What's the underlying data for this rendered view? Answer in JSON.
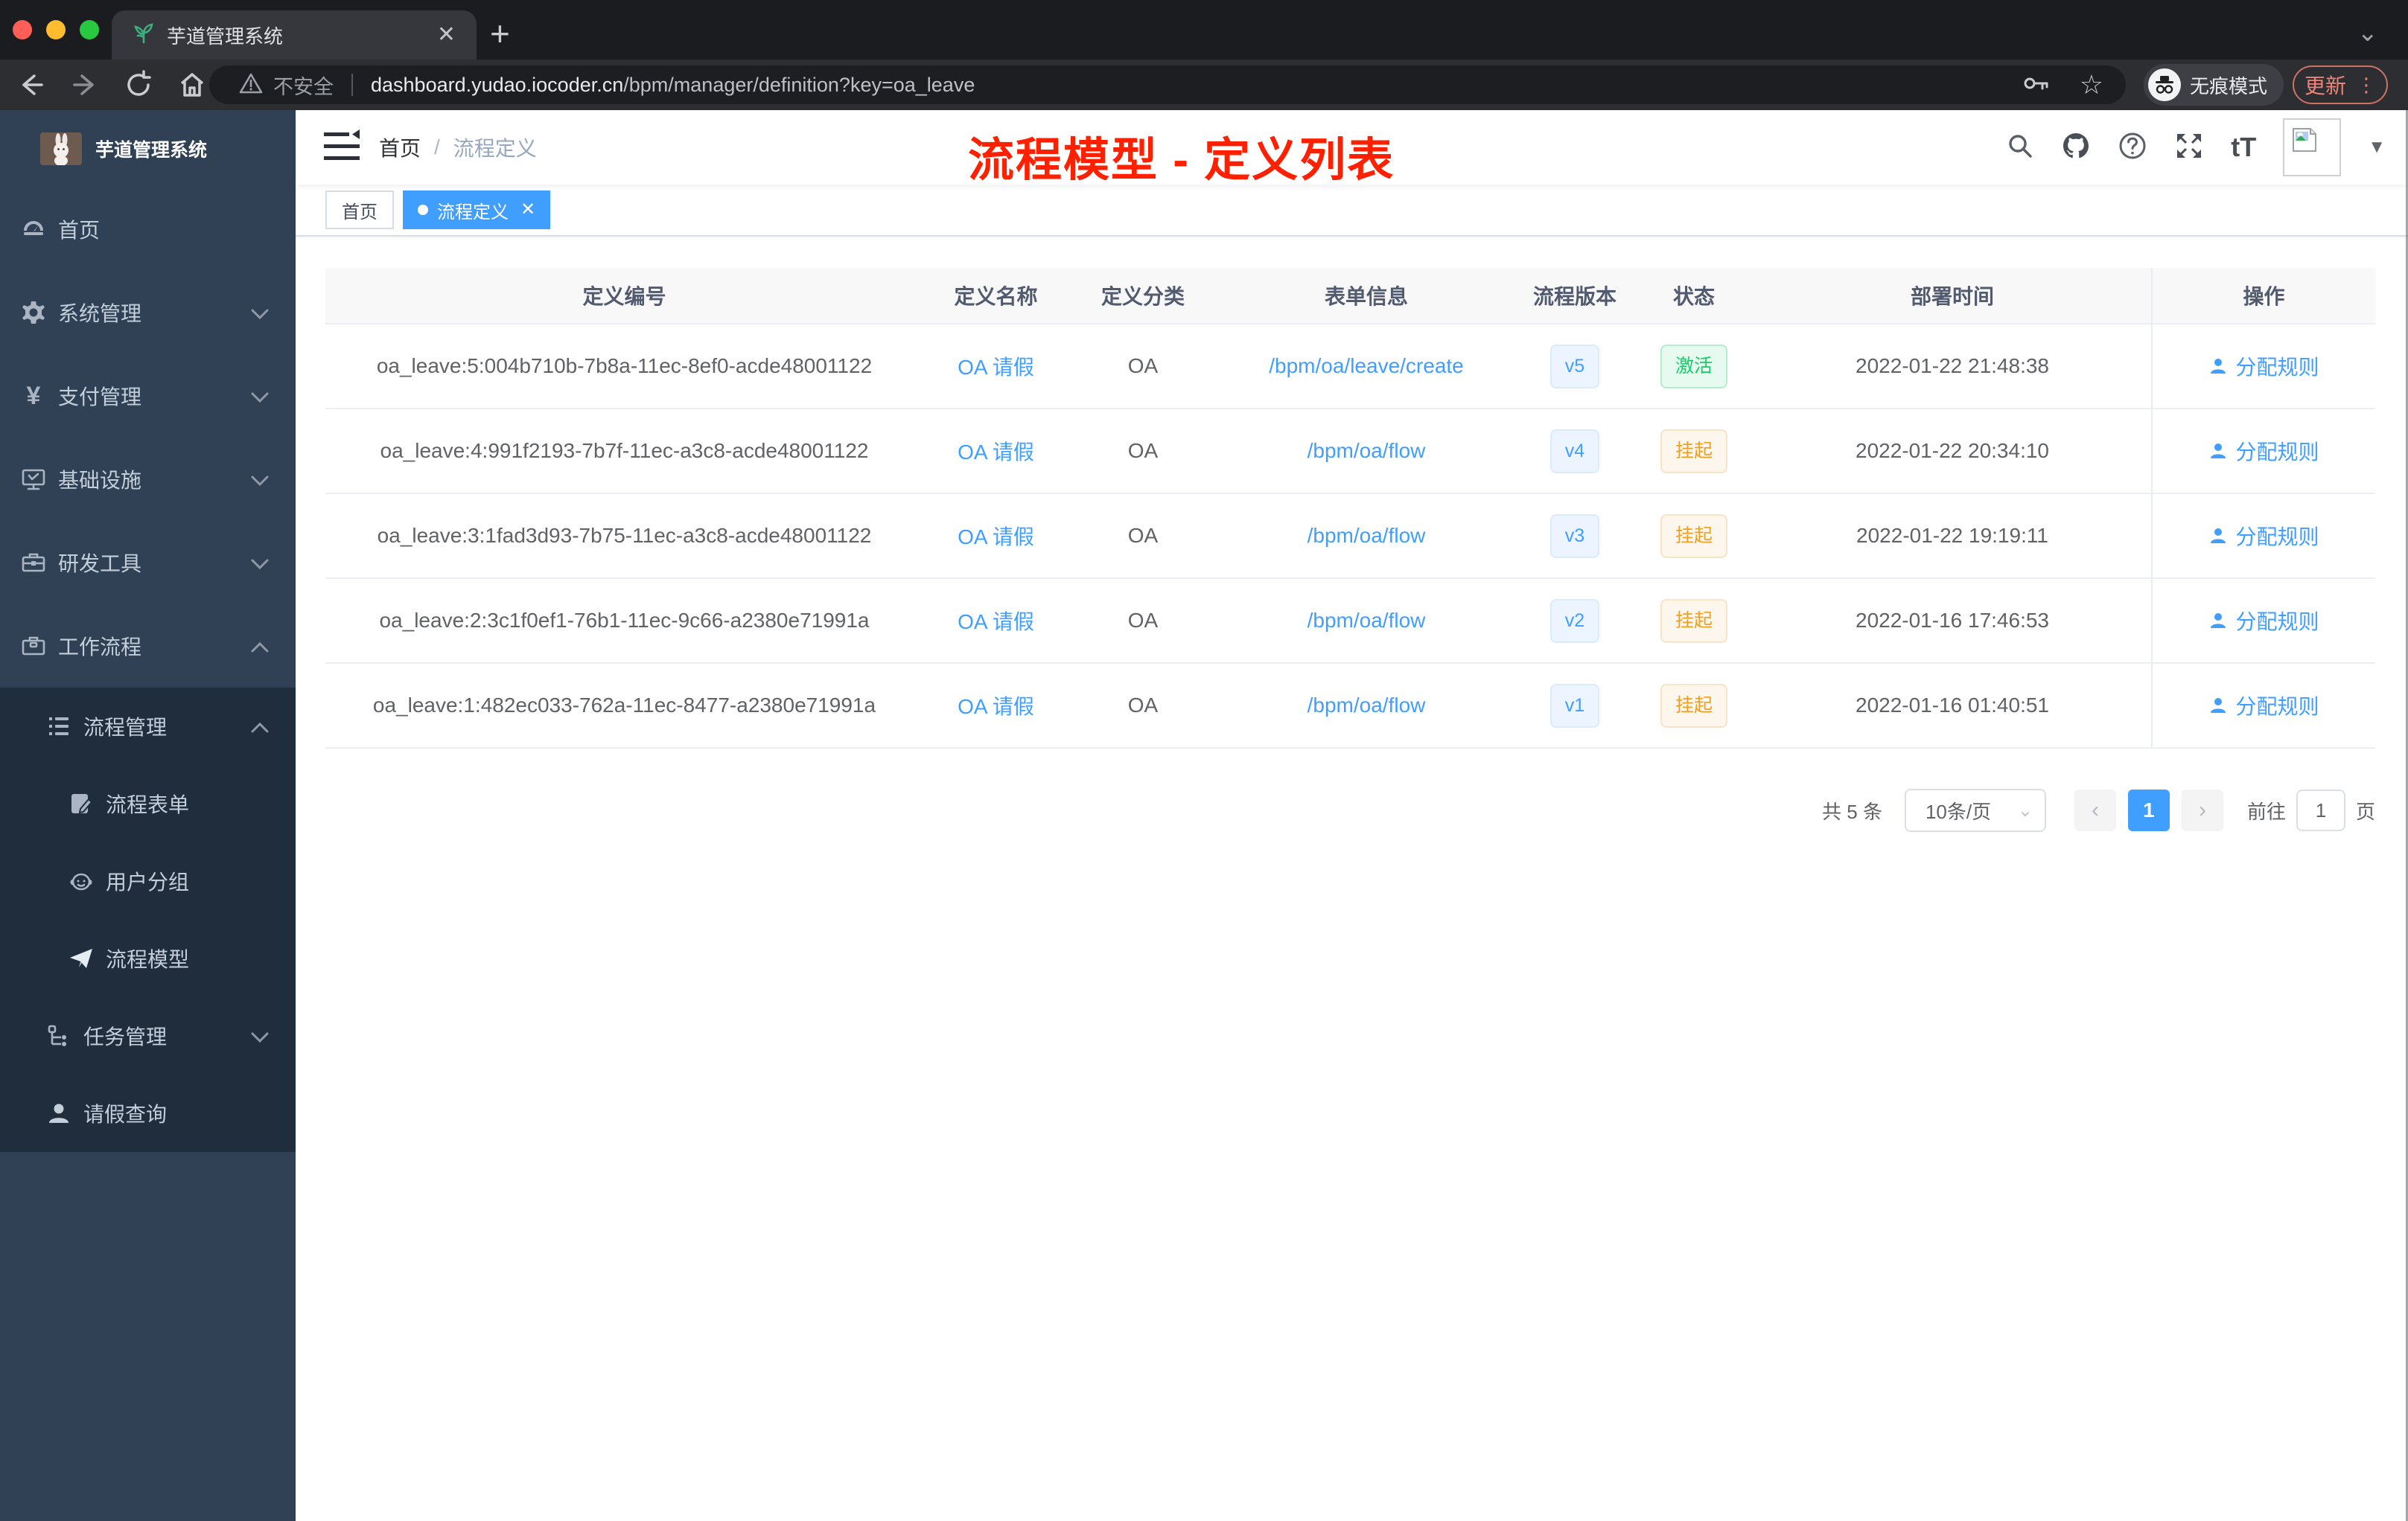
{
  "browser": {
    "tab_title": "芋道管理系统",
    "new_tab_glyph": "+",
    "close_glyph": "✕",
    "security_label": "不安全",
    "url_domain": "dashboard.yudao.iocoder.cn",
    "url_path": "/bpm/manager/definition?key=oa_leave",
    "incognito_label": "无痕模式",
    "update_label": "更新",
    "menu_dots": "⋮",
    "star_glyph": "☆",
    "tab_caret": "⌄"
  },
  "sidebar": {
    "logo_title": "芋道管理系统",
    "items": [
      {
        "label": "首页",
        "level": 1,
        "icon": "dashboard-icon"
      },
      {
        "label": "系统管理",
        "level": 1,
        "icon": "gear-icon",
        "arrow": "down"
      },
      {
        "label": "支付管理",
        "level": 1,
        "icon": "yen-icon",
        "arrow": "down"
      },
      {
        "label": "基础设施",
        "level": 1,
        "icon": "monitor-icon",
        "arrow": "down"
      },
      {
        "label": "研发工具",
        "level": 1,
        "icon": "toolbox-icon",
        "arrow": "down"
      },
      {
        "label": "工作流程",
        "level": 1,
        "icon": "briefcase-icon",
        "arrow": "up"
      },
      {
        "label": "流程管理",
        "level": 2,
        "icon": "list-tree-icon",
        "arrow": "up"
      },
      {
        "label": "流程表单",
        "level": 3,
        "icon": "form-edit-icon"
      },
      {
        "label": "用户分组",
        "level": 3,
        "icon": "robot-icon"
      },
      {
        "label": "流程模型",
        "level": 3,
        "icon": "paper-plane-icon"
      },
      {
        "label": "任务管理",
        "level": 2,
        "icon": "org-tree-icon",
        "arrow": "down"
      },
      {
        "label": "请假查询",
        "level": 2,
        "icon": "user-icon"
      }
    ],
    "yen_glyph": "¥"
  },
  "navbar": {
    "breadcrumb_home": "首页",
    "breadcrumb_sep": "/",
    "breadcrumb_current": "流程定义",
    "annotation": "流程模型 - 定义列表",
    "fontsize_glyph": "tT",
    "caret_glyph": "▼"
  },
  "tags_view": {
    "home": "首页",
    "active_label": "流程定义",
    "active_close": "✕"
  },
  "table": {
    "columns": [
      "定义编号",
      "定义名称",
      "定义分类",
      "表单信息",
      "流程版本",
      "状态",
      "部署时间",
      "操作"
    ],
    "rows": [
      {
        "id": "oa_leave:5:004b710b-7b8a-11ec-8ef0-acde48001122",
        "name": "OA 请假",
        "category": "OA",
        "form": "/bpm/oa/leave/create",
        "version": "v5",
        "status": "激活",
        "status_type": "success",
        "deploy_time": "2022-01-22 21:48:38",
        "action": "分配规则"
      },
      {
        "id": "oa_leave:4:991f2193-7b7f-11ec-a3c8-acde48001122",
        "name": "OA 请假",
        "category": "OA",
        "form": "/bpm/oa/flow",
        "version": "v4",
        "status": "挂起",
        "status_type": "warning",
        "deploy_time": "2022-01-22 20:34:10",
        "action": "分配规则"
      },
      {
        "id": "oa_leave:3:1fad3d93-7b75-11ec-a3c8-acde48001122",
        "name": "OA 请假",
        "category": "OA",
        "form": "/bpm/oa/flow",
        "version": "v3",
        "status": "挂起",
        "status_type": "warning",
        "deploy_time": "2022-01-22 19:19:11",
        "action": "分配规则"
      },
      {
        "id": "oa_leave:2:3c1f0ef1-76b1-11ec-9c66-a2380e71991a",
        "name": "OA 请假",
        "category": "OA",
        "form": "/bpm/oa/flow",
        "version": "v2",
        "status": "挂起",
        "status_type": "warning",
        "deploy_time": "2022-01-16 17:46:53",
        "action": "分配规则"
      },
      {
        "id": "oa_leave:1:482ec033-762a-11ec-8477-a2380e71991a",
        "name": "OA 请假",
        "category": "OA",
        "form": "/bpm/oa/flow",
        "version": "v1",
        "status": "挂起",
        "status_type": "warning",
        "deploy_time": "2022-01-16 01:40:51",
        "action": "分配规则"
      }
    ]
  },
  "pagination": {
    "total_text": "共 5 条",
    "page_size": "10条/页",
    "select_caret": "⌄",
    "prev_glyph": "‹",
    "current_page": "1",
    "next_glyph": "›",
    "goto_label": "前往",
    "goto_value": "1",
    "page_suffix": "页"
  },
  "colors": {
    "primary": "#409eff",
    "success": "#13ce66",
    "warning": "#f0a020",
    "annotation_red": "#ff2000",
    "sidebar_bg": "#304156",
    "submenu_bg": "#1f2d3d"
  }
}
